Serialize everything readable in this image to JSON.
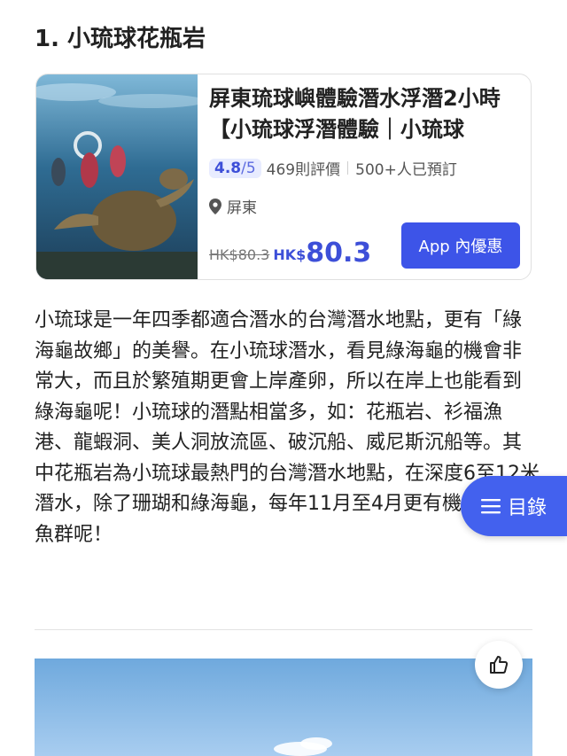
{
  "section": {
    "title": "1. 小琉球花瓶岩"
  },
  "product": {
    "title": "屏東琉球嶼體驗潛水浮潛2小時【小琉球浮潛體驗｜小琉球",
    "rating": "4.8",
    "rating_max": "/5",
    "reviews": "469則評價",
    "bookings": "500+人已預訂",
    "location": "屏東",
    "old_price": "HK$80.3",
    "currency": "HK$",
    "price": "80.3",
    "app_button": "App 內優惠"
  },
  "article": {
    "paragraph": "小琉球是一年四季都適合潛水的台灣潛水地點，更有「綠海龜故鄉」的美譽。在小琉球潛水，看見綠海龜的機會非常大，而且於繁殖期更會上岸產卵，所以在岸上也能看到綠海龜呢！小琉球的潛點相當多，如：花瓶岩、衫福漁港、龍蝦洞、美人洞放流區、破沉船、威尼斯沉船等。其中花瓶岩為小琉球最熱門的台灣潛水地點，在深度6至12米潛水，除了珊瑚和綠海龜，每年11月至4月更有機會遇到梭魚群呢！"
  },
  "toc": {
    "label": "目錄"
  },
  "colors": {
    "accent": "#3d54e8",
    "toc": "#4361ee",
    "rating_bg": "#e8ecff"
  },
  "icons": {
    "location": "location-pin-icon",
    "toc": "menu-icon",
    "like": "thumbs-up-icon"
  }
}
